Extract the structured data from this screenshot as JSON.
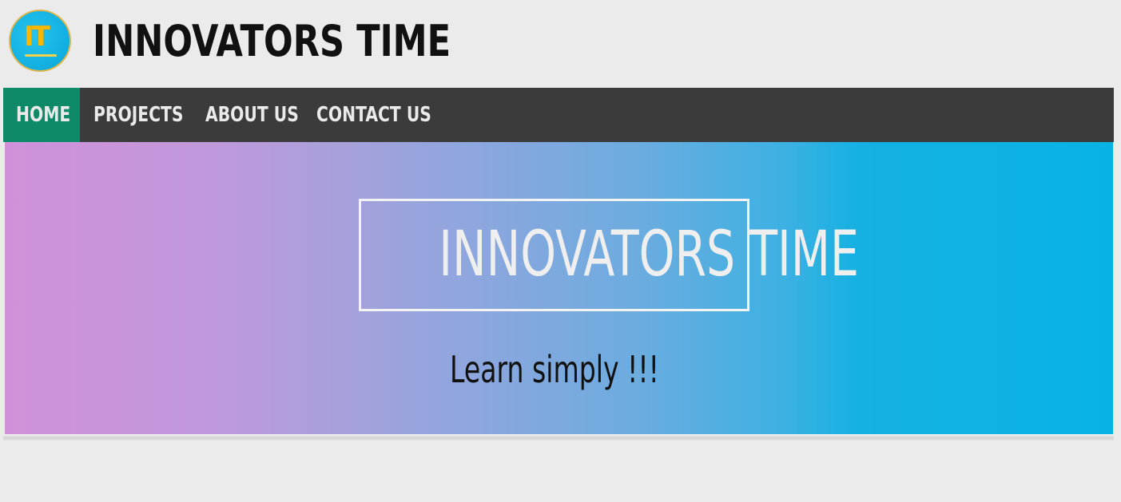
{
  "header": {
    "logo_text": "IT",
    "site_title": "INNOVATORS TIME"
  },
  "nav": {
    "items": [
      {
        "label": "HOME",
        "active": true
      },
      {
        "label": "PROJECTS",
        "active": false
      },
      {
        "label": "ABOUT US",
        "active": false
      },
      {
        "label": "CONTACT US",
        "active": false
      }
    ],
    "active_color": "#0f8a68",
    "bar_color": "#3b3b3b"
  },
  "hero": {
    "title": "INNOVATORS TIME",
    "tagline": "Learn simply !!!",
    "gradient_start": "#d191d9",
    "gradient_end": "#08b3e4"
  }
}
